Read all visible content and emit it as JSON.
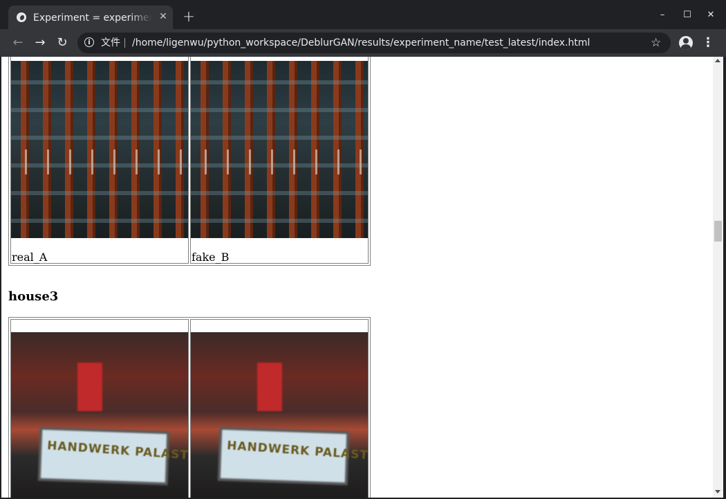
{
  "browser": {
    "tab_title": "Experiment = experiment_name",
    "tab_close": "✕",
    "new_tab": "+",
    "window_controls": {
      "minimize": "–",
      "maximize": "☐",
      "close": "✕"
    },
    "nav": {
      "back": "←",
      "forward": "→",
      "reload": "↻"
    },
    "omnibox": {
      "scheme_label": "文件",
      "url": "/home/ligenwu/python_workspace/DeblurGAN/results/experiment_name/test_latest/index.html",
      "star": "☆"
    },
    "menu": "⋮",
    "icons": {
      "favicon": "globe-icon",
      "info": "info-icon",
      "bookmark": "star-icon",
      "profile": "account-icon"
    }
  },
  "page": {
    "sections": [
      {
        "heading": "",
        "images": [
          {
            "caption": "real_A",
            "kind": "building"
          },
          {
            "caption": "fake_B",
            "kind": "building"
          }
        ]
      },
      {
        "heading": "house3",
        "images": [
          {
            "caption": "",
            "kind": "house",
            "sign_text": "HANDWERK PALAST"
          },
          {
            "caption": "",
            "kind": "house",
            "sign_text": "HANDWERK PALAST"
          }
        ]
      }
    ]
  }
}
